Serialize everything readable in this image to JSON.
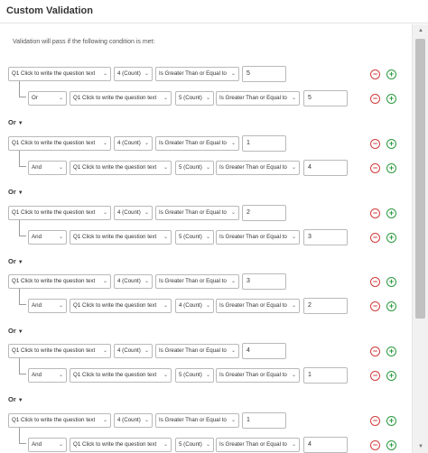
{
  "dialog": {
    "title": "Custom Validation"
  },
  "intro_text": "Validation will pass if the following condition is met:",
  "icons": {
    "remove": "minus-circle-icon",
    "add": "plus-circle-icon",
    "dropdown": "chevron-down-icon"
  },
  "colors": {
    "remove": "#d23c3c",
    "add": "#2b9a3f"
  },
  "groups": [
    {
      "separator": "",
      "first": {
        "question": "Q1 Click to write the question text",
        "metric": "4 (Count)",
        "operator": "Is Greater Than or Equal to",
        "value": "5"
      },
      "second": {
        "conjunction": "Or",
        "question": "Q1 Click to write the question text",
        "metric": "5 (Count)",
        "operator": "Is Greater Than or Equal to",
        "value": "5"
      }
    },
    {
      "separator": "Or",
      "first": {
        "question": "Q1 Click to write the question text",
        "metric": "4 (Count)",
        "operator": "Is Greater Than or Equal to",
        "value": "1"
      },
      "second": {
        "conjunction": "And",
        "question": "Q1 Click to write the question text",
        "metric": "5 (Count)",
        "operator": "Is Greater Than or Equal to",
        "value": "4"
      }
    },
    {
      "separator": "Or",
      "first": {
        "question": "Q1 Click to write the question text",
        "metric": "4 (Count)",
        "operator": "Is Greater Than or Equal to",
        "value": "2"
      },
      "second": {
        "conjunction": "And",
        "question": "Q1 Click to write the question text",
        "metric": "5 (Count)",
        "operator": "Is Greater Than or Equal to",
        "value": "3"
      }
    },
    {
      "separator": "Or",
      "first": {
        "question": "Q1 Click to write the question text",
        "metric": "4 (Count)",
        "operator": "Is Greater Than or Equal to",
        "value": "3"
      },
      "second": {
        "conjunction": "And",
        "question": "Q1 Click to write the question text",
        "metric": "4 (Count)",
        "operator": "Is Greater Than or Equal to",
        "value": "2"
      }
    },
    {
      "separator": "Or",
      "first": {
        "question": "Q1 Click to write the question text",
        "metric": "4 (Count)",
        "operator": "Is Greater Than or Equal to",
        "value": "4"
      },
      "second": {
        "conjunction": "And",
        "question": "Q1 Click to write the question text",
        "metric": "5 (Count)",
        "operator": "Is Greater Than or Equal to",
        "value": "1"
      }
    },
    {
      "separator": "Or",
      "first": {
        "question": "Q1 Click to write the question text",
        "metric": "4 (Count)",
        "operator": "Is Greater Than or Equal to",
        "value": "1"
      },
      "second": {
        "conjunction": "And",
        "question": "Q1 Click to write the question text",
        "metric": "5 (Count)",
        "operator": "Is Greater Than or Equal to",
        "value": "4"
      }
    }
  ]
}
